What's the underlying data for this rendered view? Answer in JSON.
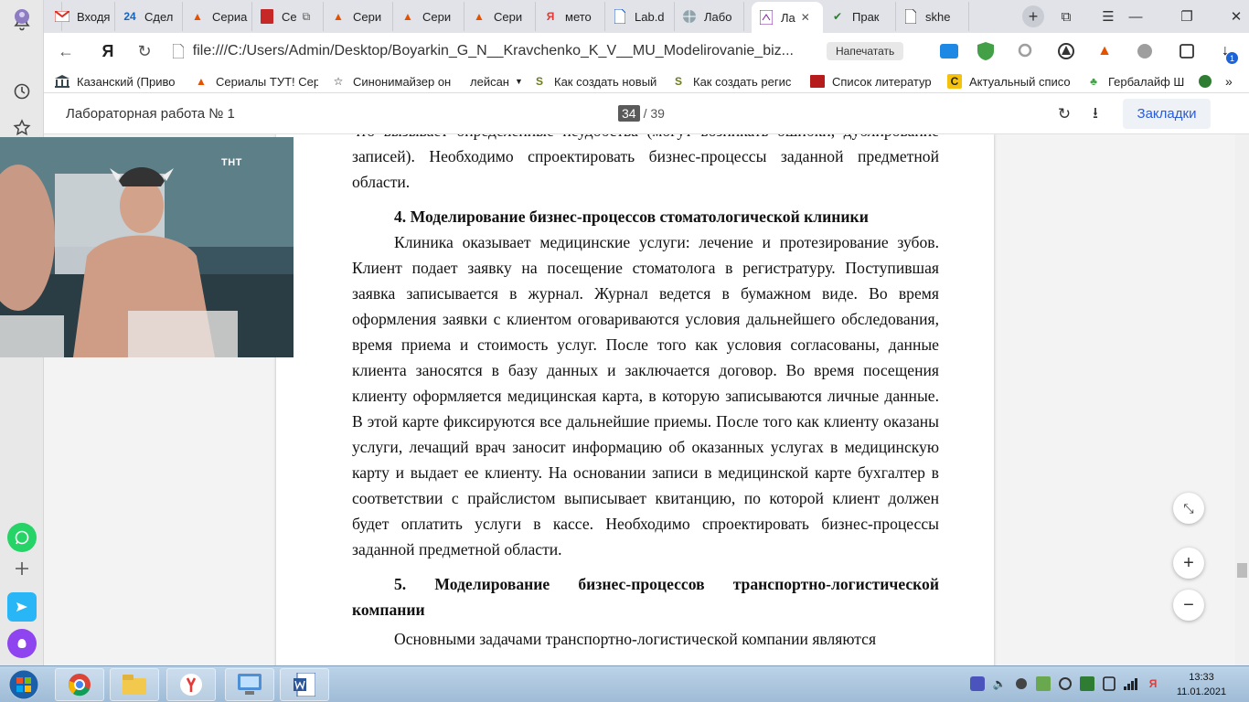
{
  "tabs": [
    {
      "label": "",
      "icon": "user-avatar-icon",
      "color": "#8e7cc3"
    },
    {
      "label": "Входя",
      "icon": "gmail-icon",
      "color": "#d93025"
    },
    {
      "label": "Сдел",
      "icon": "24-icon",
      "color": "#1565c0"
    },
    {
      "label": "Сериа",
      "icon": "fox-icon",
      "color": "#e65100"
    },
    {
      "label": "Се",
      "icon": "red-book-icon",
      "color": "#c62828"
    },
    {
      "label": "Сери",
      "icon": "fox-icon",
      "color": "#e65100"
    },
    {
      "label": "Сери",
      "icon": "fox-icon",
      "color": "#e65100"
    },
    {
      "label": "Сери",
      "icon": "fox-icon",
      "color": "#e65100"
    },
    {
      "label": "мето",
      "icon": "yandex-icon",
      "color": "#e53935"
    },
    {
      "label": "Lab.d",
      "icon": "document-icon",
      "color": "#1e56b4"
    },
    {
      "label": "Лабо",
      "icon": "globe-icon",
      "color": "#607d8b"
    },
    {
      "label": "Ла",
      "icon": "pdf-icon",
      "color": "#7b1fa2"
    },
    {
      "label": "Прак",
      "icon": "check-icon",
      "color": "#2e7d32"
    },
    {
      "label": "skhe",
      "icon": "file-icon",
      "color": "#444444"
    }
  ],
  "address": {
    "url": "file:///C:/Users/Admin/Desktop/Boyarkin_G_N__Kravchenko_K_V__MU_Modelirovanie_biz...",
    "print_label": "Напечатать"
  },
  "bookmarks": [
    {
      "label": "Казанский (Приво",
      "icon": "bank-icon"
    },
    {
      "label": "Сериалы ТУТ! Сер",
      "icon": "fox-icon"
    },
    {
      "label": "Синонимайзер он",
      "icon": "star-icon"
    },
    {
      "label": "лейсан",
      "icon": "folder-dropdown-icon"
    },
    {
      "label": "Как создать новый",
      "icon": "s-icon"
    },
    {
      "label": "Как создать регис",
      "icon": "s-icon"
    },
    {
      "label": "Список литератур",
      "icon": "book-icon"
    },
    {
      "label": "Актуальный списо",
      "icon": "c-icon"
    },
    {
      "label": "Гербалайф Ш",
      "icon": "leaf-icon"
    }
  ],
  "pdf": {
    "title": "Лабораторная работа № 1",
    "current_page": "34",
    "total_pages": "/ 39",
    "bookmarks_label": "Закладки"
  },
  "document": {
    "para_top": "что вызывает определенные неудобства (могут возникать ошибки, дублирование записей). Необходимо спроектировать бизнес-процессы заданной предметной области.",
    "heading4": "4. Моделирование бизнес-процессов стоматологической клиники",
    "para4": "Клиника оказывает медицинские услуги: лечение и протезирование зубов. Клиент подает заявку на посещение стоматолога в регистратуру. Поступившая заявка записывается в журнал. Журнал ведется в бумажном виде. Во время оформления заявки с клиентом оговариваются условия дальнейшего обследования, время приема и стоимость услуг. После того как условия согласованы, данные клиента заносятся в базу данных и заключается договор. Во время посещения клиенту оформляется медицинская карта, в которую записываются личные данные. В этой карте фиксируются все дальнейшие приемы. После того как клиенту оказаны услуги, лечащий врач заносит информацию об оказанных услугах в медицинскую карту и выдает ее клиенту. На основании записи в медицинской карте бухгалтер в соответствии с прайслистом выписывает квитанцию, по которой клиент должен будет оплатить услуги в кассе. Необходимо спроектировать бизнес-процессы заданной предметной области.",
    "heading5": "5. Моделирование бизнес-процессов транспортно-логистической компании",
    "para5": "Основными задачами транспортно-логистической компании являются"
  },
  "video": {
    "logo": "ТНТ"
  },
  "taskbar": {
    "apps": [
      {
        "name": "chrome-icon"
      },
      {
        "name": "explorer-icon"
      },
      {
        "name": "yandex-browser-icon"
      },
      {
        "name": "control-panel-icon"
      },
      {
        "name": "word-icon"
      }
    ],
    "time": "13:33",
    "date": "11.01.2021"
  },
  "colors": {
    "accent": "#2a5bd7",
    "tab_bg": "#e1e3e8"
  }
}
